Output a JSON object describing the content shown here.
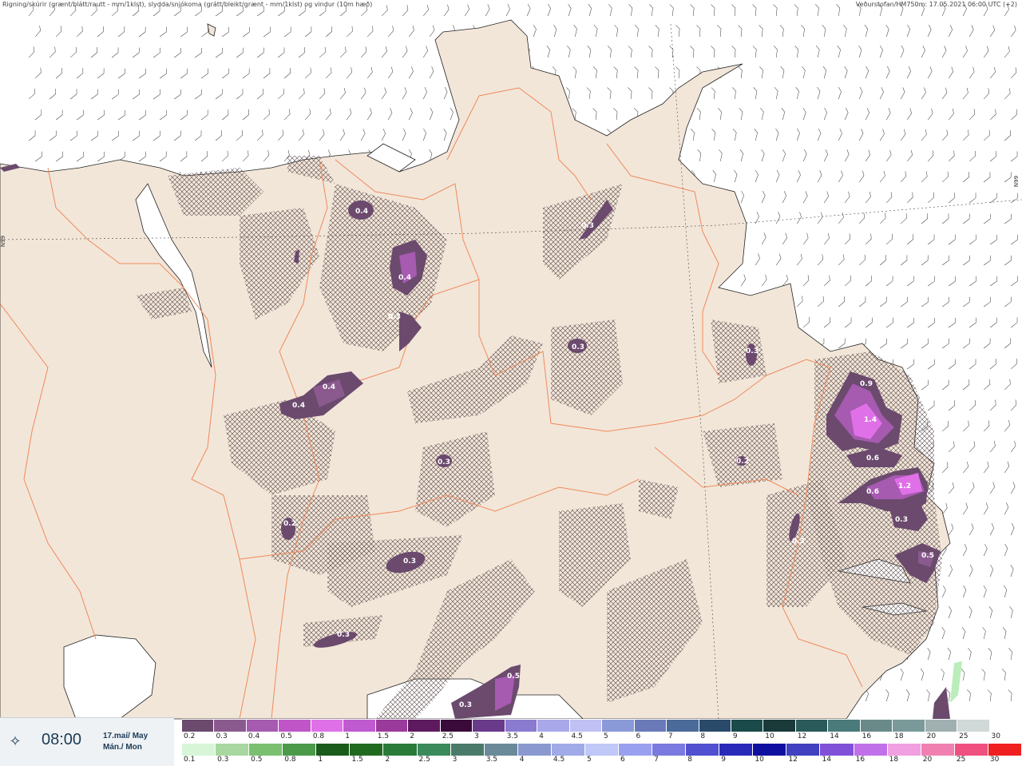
{
  "header": {
    "title": "Rigning/skúrir (grænt/blátt/rautt - mm/1klst), slydda/snjókoma (grátt/bleikt/grænt - mm/1klst) og vindur (10m hæð)",
    "source": "Veðurstofan/HM750m: 17.05.2021 06:00 UTC (+2)"
  },
  "map": {
    "graticule_label_left": "N99",
    "graticule_label_right": "N99",
    "land_color": "#f2e6d9",
    "sea_color": "#ffffff",
    "road_color": "#f08a5a",
    "precip_labels": [
      {
        "v": "0.4",
        "kind": "snow"
      },
      {
        "v": "0.3",
        "kind": "snow"
      },
      {
        "v": "0.4",
        "kind": "snow"
      },
      {
        "v": "0.3",
        "kind": "snow"
      },
      {
        "v": "0.4",
        "kind": "snow"
      },
      {
        "v": "0.4",
        "kind": "snow"
      },
      {
        "v": "0.3",
        "kind": "snow"
      },
      {
        "v": "0.3",
        "kind": "snow"
      },
      {
        "v": "0.3",
        "kind": "snow"
      },
      {
        "v": "0.2",
        "kind": "snow"
      },
      {
        "v": "0.3",
        "kind": "snow"
      },
      {
        "v": "0.3",
        "kind": "snow"
      },
      {
        "v": "0.5",
        "kind": "snow"
      },
      {
        "v": "0.3",
        "kind": "snow"
      },
      {
        "v": "0.9",
        "kind": "snow"
      },
      {
        "v": "1.4",
        "kind": "snow"
      },
      {
        "v": "0.6",
        "kind": "snow"
      },
      {
        "v": "0.6",
        "kind": "snow"
      },
      {
        "v": "1.2",
        "kind": "snow"
      },
      {
        "v": "0.3",
        "kind": "snow"
      },
      {
        "v": "0.5",
        "kind": "snow"
      },
      {
        "v": "0.3",
        "kind": "snow"
      },
      {
        "v": "0.2",
        "kind": "snow"
      }
    ]
  },
  "timebox": {
    "icon": "wind-icon",
    "time": "08:00",
    "date_line1": "17.maí/ May",
    "date_line2": "Mán./ Mon"
  },
  "legend": {
    "snow_labels": [
      "0.2",
      "0.3",
      "0.4",
      "0.5",
      "0.8",
      "1",
      "1.5",
      "2",
      "2.5",
      "3",
      "3.5",
      "4",
      "4.5",
      "5",
      "6",
      "7",
      "8",
      "9",
      "10",
      "12",
      "14",
      "16",
      "18",
      "20",
      "25",
      "30"
    ],
    "snow_colors": [
      "#6b4a6e",
      "#8a5a8f",
      "#a65ab0",
      "#c055c8",
      "#e070e8",
      "#c05ad0",
      "#9a3a9a",
      "#5e1a5e",
      "#3a0a3a",
      "#6a3a8a",
      "#8a7ad0",
      "#a8a8ea",
      "#c0c0f5",
      "#8a9ad8",
      "#6a7ab8",
      "#4a6a9a",
      "#2a4a6a",
      "#1a4a4a",
      "#1a3a3a",
      "#2a5a5a",
      "#4a7a7a",
      "#6a8a8a",
      "#7a9a9a",
      "#a0b0b0",
      "#d0d8d8",
      "#ffffff"
    ],
    "rain_labels": [
      "0.1",
      "0.3",
      "0.5",
      "0.8",
      "1",
      "1.5",
      "2",
      "2.5",
      "3",
      "3.5",
      "4",
      "4.5",
      "5",
      "6",
      "7",
      "8",
      "9",
      "10",
      "12",
      "14",
      "16",
      "18",
      "20",
      "25",
      "30"
    ],
    "rain_colors": [
      "#d8f5d8",
      "#a8d8a0",
      "#7ac070",
      "#4a9a4a",
      "#1a5a1a",
      "#206a20",
      "#2a7a3a",
      "#3a8a5a",
      "#4a7a6a",
      "#6a8a9a",
      "#8a9ad0",
      "#a0aae8",
      "#c0c8f8",
      "#9aa0f0",
      "#7a7ae0",
      "#5050d0",
      "#2a2ab8",
      "#1010a0",
      "#4040c0",
      "#8050d8",
      "#c070e8",
      "#f0a0e0",
      "#f080b0",
      "#f05080",
      "#f02020"
    ]
  }
}
